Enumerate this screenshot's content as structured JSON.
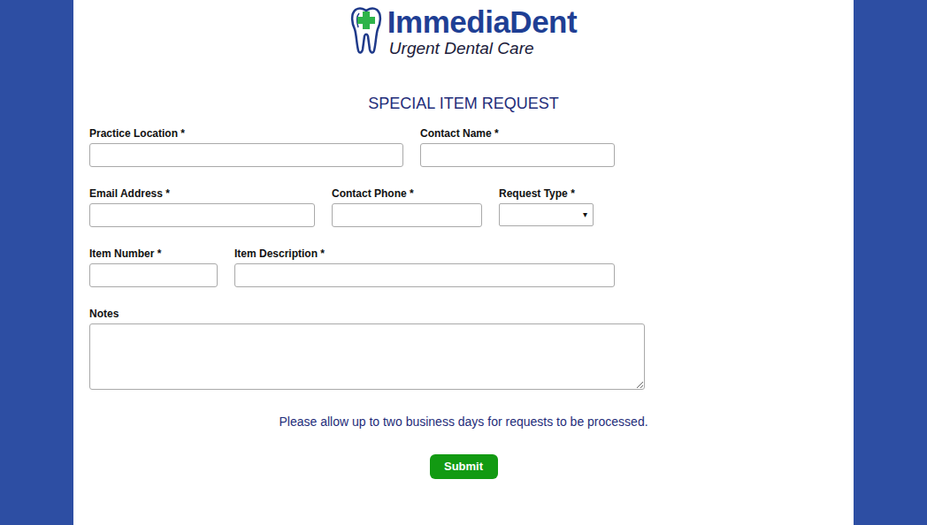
{
  "logo": {
    "name": "ImmediaDent",
    "tagline": "Urgent Dental Care"
  },
  "title": "SPECIAL ITEM REQUEST",
  "form": {
    "rows": [
      [
        {
          "label": "Practice Location *",
          "kind": "text",
          "value": ""
        },
        {
          "label": "Contact Name *",
          "kind": "text",
          "value": ""
        }
      ],
      [
        {
          "label": "Email Address *",
          "kind": "text",
          "value": ""
        },
        {
          "label": "Contact Phone *",
          "kind": "text",
          "value": ""
        },
        {
          "label": "Request Type *",
          "kind": "select",
          "value": "",
          "arrow": "▾"
        }
      ],
      [
        {
          "label": "Item Number *",
          "kind": "text",
          "value": ""
        },
        {
          "label": "Item Description *",
          "kind": "text",
          "value": ""
        }
      ],
      [
        {
          "label": "Notes",
          "kind": "textarea",
          "value": ""
        }
      ]
    ]
  },
  "notice": "Please allow up to two business days for requests to be processed.",
  "submit": "Submit"
}
